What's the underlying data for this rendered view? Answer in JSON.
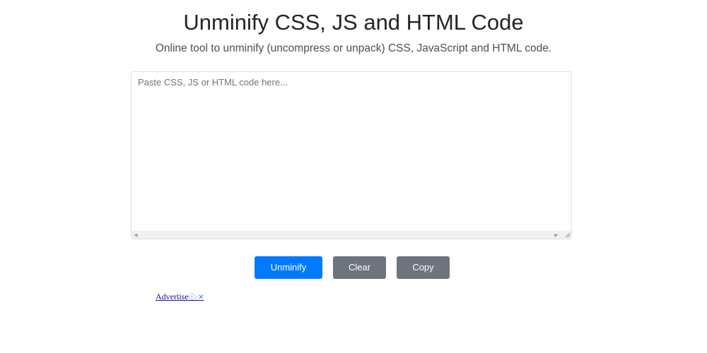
{
  "header": {
    "title": "Unminify CSS, JS and HTML Code",
    "subtitle": "Online tool to unminify (uncompress or unpack) CSS, JavaScript and HTML code."
  },
  "editor": {
    "value": "",
    "placeholder": "Paste CSS, JS or HTML code here...",
    "scroll_left_icon": "chevron-left-icon",
    "scroll_right_icon": "chevron-right-icon",
    "resize_icon": "resize-grip-icon"
  },
  "actions": {
    "unminify_label": "Unminify",
    "clear_label": "Clear",
    "copy_label": "Copy"
  },
  "ad": {
    "label": "Advertise",
    "icons": "ⓘ:✕",
    "info_icon": "info-icon",
    "close_icon": "close-icon"
  },
  "colors": {
    "primary": "#007bff",
    "secondary": "#6c757d",
    "text": "#212529",
    "link": "#1a0dab"
  }
}
